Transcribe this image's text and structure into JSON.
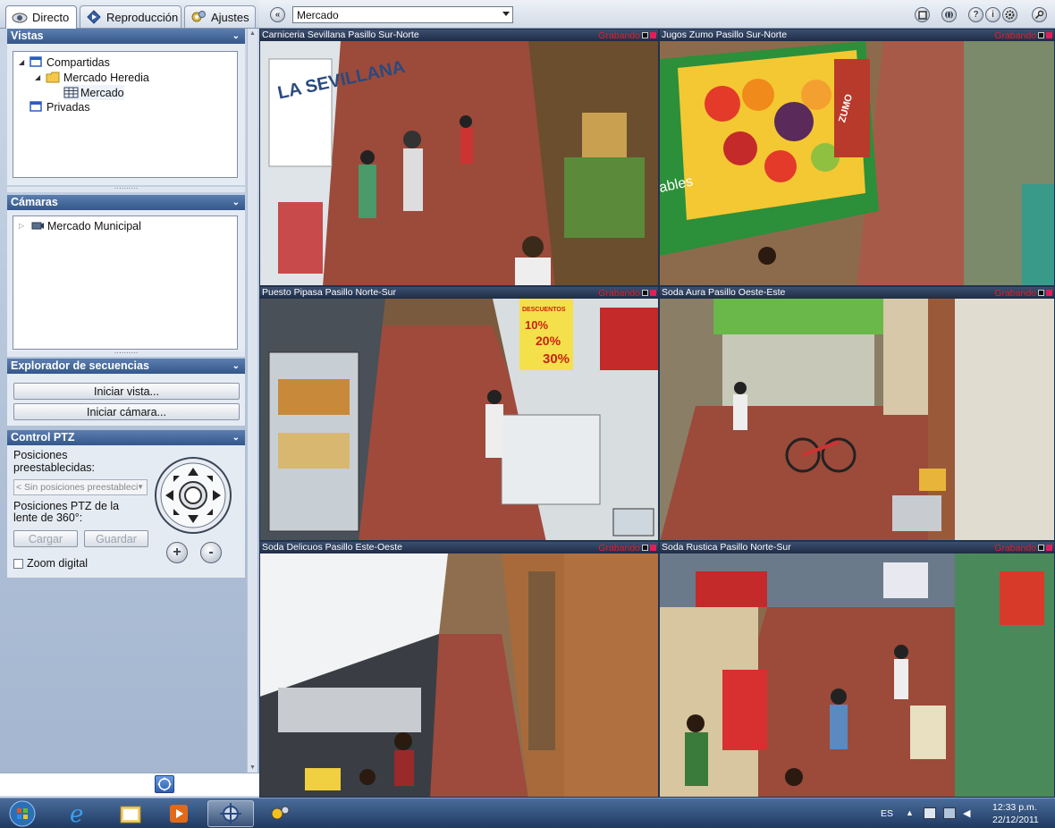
{
  "tabs": [
    {
      "label": "Directo",
      "icon": "eye-icon",
      "active": true
    },
    {
      "label": "Reproducción",
      "icon": "playback-icon",
      "active": false
    },
    {
      "label": "Ajustes",
      "icon": "settings-icon",
      "active": false
    }
  ],
  "viewbar": {
    "selected_view": "Mercado",
    "buttons": [
      "collapse-left-icon",
      "fullscreen-icon",
      "globe-icon",
      "help-icon",
      "info-icon",
      "gear-icon",
      "key-icon"
    ],
    "help_glyph": "?",
    "info_glyph": "i"
  },
  "panels": {
    "vistas": {
      "title": "Vistas",
      "tree": [
        {
          "label": "Compartidas",
          "level": 0,
          "expanded": true,
          "icon": "shared-views-icon"
        },
        {
          "label": "Mercado Heredia",
          "level": 1,
          "expanded": true,
          "icon": "folder-icon"
        },
        {
          "label": "Mercado",
          "level": 2,
          "icon": "grid-view-icon",
          "selected": true
        },
        {
          "label": "Privadas",
          "level": 0,
          "icon": "private-views-icon"
        }
      ]
    },
    "camaras": {
      "title": "Cámaras",
      "tree": [
        {
          "label": "Mercado Municipal",
          "icon": "camera-group-icon"
        }
      ]
    },
    "secuencias": {
      "title": "Explorador de secuencias",
      "btn_view": "Iniciar vista...",
      "btn_camera": "Iniciar cámara..."
    },
    "ptz": {
      "title": "Control PTZ",
      "presets_label": "Posiciones preestablecidas:",
      "presets_value": "< Sin posiciones preestableci",
      "lens_label": "Posiciones PTZ de la lente de 360°:",
      "btn_load": "Cargar",
      "btn_save": "Guardar",
      "zoom_label": "Zoom digital",
      "zoom_in": "+",
      "zoom_out": "-"
    }
  },
  "cameras": [
    {
      "title": "Carniceria Sevillana Pasillo Sur-Norte",
      "status": "Grabando"
    },
    {
      "title": "Jugos Zumo Pasillo Sur-Norte",
      "status": "Grabando"
    },
    {
      "title": "Puesto Pipasa Pasillo Norte-Sur",
      "status": "Grabando"
    },
    {
      "title": "Soda Aura Pasillo Oeste-Este",
      "status": "Grabando"
    },
    {
      "title": "Soda Delicuos Pasillo Este-Oeste",
      "status": "Grabando"
    },
    {
      "title": "Soda Rustica Pasillo Norte-Sur",
      "status": "Grabando"
    }
  ],
  "scene_text": {
    "sevillana_sign": "LA SEVILLANA",
    "juice_brand": "ZUMO",
    "fruit_box": "ables",
    "promo_title": "DESCUENTOS",
    "promo_10": "10%",
    "promo_20": "20%",
    "promo_30": "30%"
  },
  "taskbar": {
    "language": "ES",
    "time": "12:33 p.m.",
    "date": "22/12/2011",
    "buttons": [
      "start-orb-icon",
      "internet-explorer-icon",
      "file-explorer-icon",
      "media-player-icon",
      "surveillance-client-icon",
      "video-settings-icon"
    ]
  },
  "colors": {
    "panel_header": "#34578b",
    "recording": "#e0202a",
    "taskbar": "#1f3a63"
  }
}
